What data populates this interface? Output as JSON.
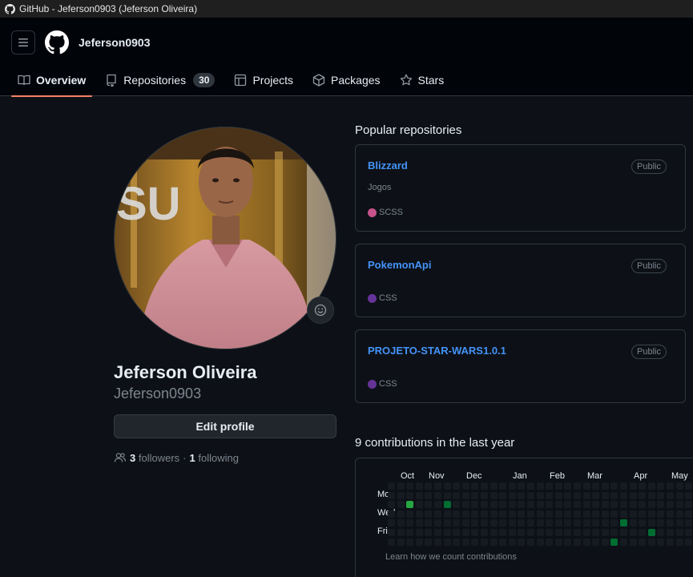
{
  "window": {
    "title": "GitHub - Jeferson0903 (Jeferson Oliveira)"
  },
  "header": {
    "username": "Jeferson0903",
    "tabs": [
      {
        "label": "Overview",
        "icon": "book-icon",
        "active": true
      },
      {
        "label": "Repositories",
        "icon": "repo-icon",
        "count": "30"
      },
      {
        "label": "Projects",
        "icon": "table-icon"
      },
      {
        "label": "Packages",
        "icon": "package-icon"
      },
      {
        "label": "Stars",
        "icon": "star-icon"
      }
    ],
    "accent": "#f78166"
  },
  "profile": {
    "full_name": "Jeferson Oliveira",
    "login": "Jeferson0903",
    "edit_label": "Edit profile",
    "followers_count": "3",
    "followers_label": "followers",
    "separator": "·",
    "following_count": "1",
    "following_label": "following"
  },
  "popular": {
    "title": "Popular repositories",
    "repos": [
      {
        "name": "Blizzard",
        "visibility": "Public",
        "description": "Jogos",
        "language": "SCSS",
        "language_color": "#c6538c"
      },
      {
        "name": "PokemonApi",
        "visibility": "Public",
        "description": "",
        "language": "CSS",
        "language_color": "#663399"
      },
      {
        "name": "PROJETO-STAR-WARS1.0.1",
        "visibility": "Public",
        "description": "",
        "language": "CSS",
        "language_color": "#663399"
      }
    ]
  },
  "contributions": {
    "title": "9 contributions in the last year",
    "months": [
      "Oct",
      "Nov",
      "Dec",
      "Jan",
      "Feb",
      "Mar",
      "Apr",
      "May"
    ],
    "days": [
      "Mon",
      "Wed",
      "Fri"
    ],
    "learn_label": "Learn how we count contributions",
    "active_cells": [
      {
        "week": 2,
        "day": 2,
        "level": 3
      },
      {
        "week": 6,
        "day": 2,
        "level": 2
      },
      {
        "week": 25,
        "day": 4,
        "level": 2
      },
      {
        "week": 24,
        "day": 6,
        "level": 2
      },
      {
        "week": 28,
        "day": 5,
        "level": 2
      }
    ]
  }
}
